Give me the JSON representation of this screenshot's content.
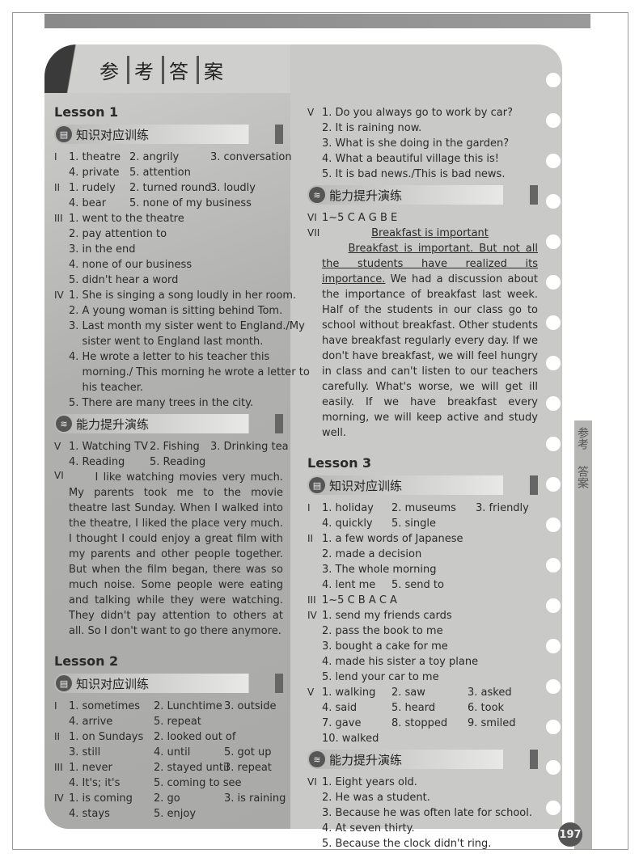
{
  "title": [
    "参",
    "考",
    "答",
    "案"
  ],
  "side_tab": [
    "参考",
    "答案"
  ],
  "page_number": "197",
  "banners": {
    "knowledge": "知识对应训练",
    "ability": "能力提升演练"
  },
  "left": [
    {
      "type": "lesson",
      "text": "Lesson 1"
    },
    {
      "type": "banner",
      "kind": "knowledge"
    },
    {
      "type": "rows",
      "cols": [
        0,
        75,
        175
      ],
      "rows": [
        {
          "rn": "I",
          "c": [
            "1. theatre",
            "2. angrily",
            "3. conversation"
          ]
        },
        {
          "rn": "",
          "c": [
            "4. private",
            "5. attention"
          ]
        },
        {
          "rn": "II",
          "c": [
            "1. rudely",
            "2. turned round",
            "3. loudly"
          ]
        },
        {
          "rn": "",
          "c": [
            "4. bear",
            "5. none of my business"
          ]
        },
        {
          "rn": "III",
          "c": [
            "1. went to the theatre"
          ]
        },
        {
          "rn": "",
          "c": [
            "2. pay attention to"
          ]
        },
        {
          "rn": "",
          "c": [
            "3. in the end"
          ]
        },
        {
          "rn": "",
          "c": [
            "4. none of our business"
          ]
        },
        {
          "rn": "",
          "c": [
            "5. didn't hear a word"
          ]
        },
        {
          "rn": "IV",
          "c": [
            "1. She is singing a song loudly in her room."
          ]
        },
        {
          "rn": "",
          "c": [
            "2. A young woman is sitting behind Tom."
          ]
        },
        {
          "rn": "",
          "c": [
            "3. Last month my sister went to England./My"
          ]
        },
        {
          "rn": "",
          "c": [
            "    sister went to England last month."
          ]
        },
        {
          "rn": "",
          "c": [
            "4. He wrote a letter to his teacher this"
          ]
        },
        {
          "rn": "",
          "c": [
            "    morning./ This morning he wrote a letter to"
          ]
        },
        {
          "rn": "",
          "c": [
            "    his teacher."
          ]
        },
        {
          "rn": "",
          "c": [
            "5. There are many trees in the city."
          ]
        }
      ]
    },
    {
      "type": "banner",
      "kind": "ability"
    },
    {
      "type": "rows",
      "cols": [
        0,
        100,
        175
      ],
      "rows": [
        {
          "rn": "V",
          "c": [
            "1. Watching TV",
            "2. Fishing",
            "3. Drinking tea"
          ]
        },
        {
          "rn": "",
          "c": [
            "4. Reading",
            "5. Reading"
          ]
        }
      ]
    },
    {
      "type": "para",
      "rn": "VI",
      "text": "I like watching movies very much. My parents took me to the movie theatre last Sunday. When I walked into the theatre, I liked the place very much. I thought I could enjoy a great film with my parents and other people together. But when the film began, there was so much noise. Some people were eating and talking while they were watching. They didn't pay attention to others at all. So I don't want to go there anymore."
    },
    {
      "type": "lesson",
      "text": "Lesson 2",
      "gap": true
    },
    {
      "type": "banner",
      "kind": "knowledge"
    },
    {
      "type": "rows",
      "cols": [
        0,
        105,
        192
      ],
      "rows": [
        {
          "rn": "I",
          "c": [
            "1. sometimes",
            "2. Lunchtime",
            "3. outside"
          ]
        },
        {
          "rn": "",
          "c": [
            "4. arrive",
            "5. repeat"
          ]
        },
        {
          "rn": "II",
          "c": [
            "1. on Sundays",
            "2. looked out of"
          ]
        },
        {
          "rn": "",
          "c": [
            "3. still",
            "4. until",
            "5. got up"
          ]
        },
        {
          "rn": "III",
          "c": [
            "1. never",
            "2. stayed until",
            "3. repeat"
          ]
        },
        {
          "rn": "",
          "c": [
            "4. It's; it's",
            "5. coming to see"
          ]
        },
        {
          "rn": "IV",
          "c": [
            "1. is coming",
            "2. go",
            "3. is raining"
          ]
        },
        {
          "rn": "",
          "c": [
            "4. stays",
            "5. enjoy"
          ]
        }
      ]
    }
  ],
  "right": [
    {
      "type": "rows",
      "cols": [
        0,
        90,
        190
      ],
      "rows": [
        {
          "rn": "V",
          "c": [
            "1. Do you always go to work by car?"
          ]
        },
        {
          "rn": "",
          "c": [
            "2. It is raining now."
          ]
        },
        {
          "rn": "",
          "c": [
            "3. What is she doing in the garden?"
          ]
        },
        {
          "rn": "",
          "c": [
            "4. What a beautiful village this is!"
          ]
        },
        {
          "rn": "",
          "c": [
            "5. It is bad news./This is bad news."
          ]
        }
      ]
    },
    {
      "type": "banner",
      "kind": "ability"
    },
    {
      "type": "rows",
      "cols": [
        0,
        90,
        190
      ],
      "rows": [
        {
          "rn": "VI",
          "c": [
            "1~5 C A G B E"
          ]
        }
      ]
    },
    {
      "type": "essay",
      "rn": "VII",
      "heading": "Breakfast is important",
      "underlined": "Breakfast is important. But not all the students have realized its importance.",
      "text": " We had a discussion about the importance of breakfast last week. Half of the students in our class go to school without breakfast. Other students have breakfast regularly every day. If we don't have breakfast, we will feel hungry in class and can't listen to our teachers carefully. What's worse, we will get ill easily. If we have breakfast every morning, we will keep active and study well."
    },
    {
      "type": "lesson",
      "text": "Lesson 3",
      "gap": true
    },
    {
      "type": "banner",
      "kind": "knowledge"
    },
    {
      "type": "rows",
      "cols": [
        0,
        86,
        190
      ],
      "rows": [
        {
          "rn": "I",
          "c": [
            "1. holiday",
            "2. museums",
            "3. friendly"
          ]
        },
        {
          "rn": "",
          "c": [
            "4. quickly",
            "5. single"
          ]
        },
        {
          "rn": "II",
          "c": [
            "1. a few words of Japanese"
          ]
        },
        {
          "rn": "",
          "c": [
            "2. made a decision"
          ]
        },
        {
          "rn": "",
          "c": [
            "3. The whole morning"
          ]
        },
        {
          "rn": "",
          "c": [
            "4. lent me",
            "5. send to"
          ]
        },
        {
          "rn": "III",
          "c": [
            "1~5 C B A C A"
          ]
        },
        {
          "rn": "IV",
          "c": [
            "1. send my friends cards"
          ]
        },
        {
          "rn": "",
          "c": [
            "2. pass the book to me"
          ]
        },
        {
          "rn": "",
          "c": [
            "3. bought a cake for me"
          ]
        },
        {
          "rn": "",
          "c": [
            "4. made his sister a toy plane"
          ]
        },
        {
          "rn": "",
          "c": [
            "5. lend your car to me"
          ]
        }
      ]
    },
    {
      "type": "rows",
      "cols": [
        0,
        86,
        180
      ],
      "rows": [
        {
          "rn": "V",
          "c": [
            "1. walking",
            "2. saw",
            "3. asked"
          ]
        },
        {
          "rn": "",
          "c": [
            "4. said",
            "5. heard",
            "6. took"
          ]
        },
        {
          "rn": "",
          "c": [
            "7. gave",
            "8. stopped",
            "9. smiled"
          ]
        },
        {
          "rn": "",
          "c": [
            "10. walked"
          ]
        }
      ]
    },
    {
      "type": "banner",
      "kind": "ability"
    },
    {
      "type": "rows",
      "cols": [
        0,
        86,
        180
      ],
      "rows": [
        {
          "rn": "VI",
          "c": [
            "1. Eight years old."
          ]
        },
        {
          "rn": "",
          "c": [
            "2. He was a student."
          ]
        },
        {
          "rn": "",
          "c": [
            "3. Because he was often late for school."
          ]
        },
        {
          "rn": "",
          "c": [
            "4. At seven thirty."
          ]
        },
        {
          "rn": "",
          "c": [
            "5. Because the clock didn't ring."
          ]
        }
      ]
    }
  ]
}
